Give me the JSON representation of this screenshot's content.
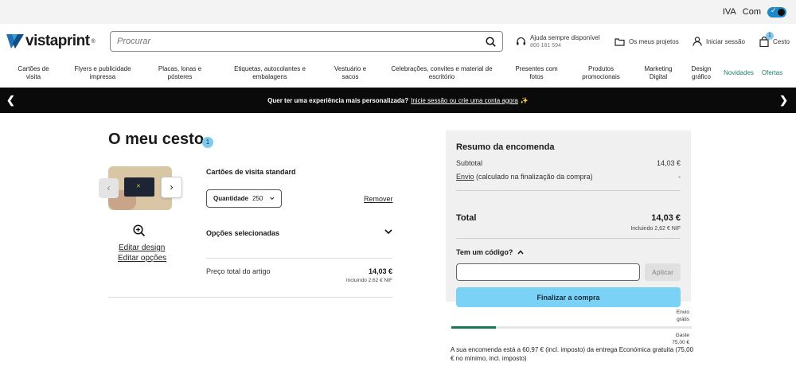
{
  "topbar": {
    "vat_label": "IVA",
    "vat_value": "Com"
  },
  "brand": {
    "name": "vistaprint",
    "registered": "®"
  },
  "search": {
    "placeholder": "Procurar"
  },
  "header_links": {
    "help_title": "Ajuda sempre disponível",
    "help_phone": "800 181 594",
    "projects": "Os meus projetos",
    "login": "Iniciar sessão",
    "cart": "Cesto",
    "cart_count": "1"
  },
  "nav": [
    {
      "line1": "Cartões de",
      "line2": "visita"
    },
    {
      "line1": "Flyers e publicidade",
      "line2": "impressa"
    },
    {
      "line1": "Placas, lonas e",
      "line2": "pósteres"
    },
    {
      "line1": "Etiquetas, autocolantes e",
      "line2": "embalagens"
    },
    {
      "line1": "Vestuário e",
      "line2": "sacos"
    },
    {
      "line1": "Celebrações, convites e material de",
      "line2": "escritório"
    },
    {
      "line1": "Presentes com",
      "line2": "fotos"
    },
    {
      "line1": "Produtos",
      "line2": "promocionais"
    },
    {
      "line1": "Marketing",
      "line2": "Digital"
    },
    {
      "line1": "Design",
      "line2": "gráfico"
    },
    {
      "line1": "Novidades",
      "line2": ""
    },
    {
      "line1": "Ofertas",
      "line2": ""
    }
  ],
  "banner": {
    "text": "Quer ter uma experiência mais personalizada?",
    "link": "Inicie sessão ou crie uma conta agora",
    "emoji": "✨"
  },
  "cart": {
    "title": "O meu cesto",
    "count": "1",
    "item": {
      "name": "Cartões de visita standard",
      "quantity_label": "Quantidade",
      "quantity_value": "250",
      "remove": "Remover",
      "edit_design": "Editar design",
      "edit_options": "Editar opções",
      "options_label": "Opções selecionadas",
      "price_label": "Preço total do artigo",
      "price": "14,03 €",
      "price_sub": "Incluindo 2,62 € NIF"
    }
  },
  "summary": {
    "title": "Resumo da encomenda",
    "subtotal_label": "Subtotal",
    "subtotal_value": "14,03 €",
    "shipping_link": "Envio",
    "shipping_note": "(calculado na finalização da compra)",
    "shipping_value": "-",
    "total_label": "Total",
    "total_value": "14,03 €",
    "total_sub": "Incluindo 2,62 € NIF",
    "code_question": "Tem um código?",
    "apply": "Aplicar",
    "checkout": "Finalizar a compra"
  },
  "shipping_progress": {
    "start_line1": "Envio",
    "start_line2": "grátis",
    "end_line1": "Gaste",
    "end_line2": "75,00 €",
    "fraction": 0.187,
    "note": "A sua encomenda está a 60,97 € (incl. imposto) da entrega Económica gratuita (75,00 € no mínimo, incl. imposto)"
  }
}
